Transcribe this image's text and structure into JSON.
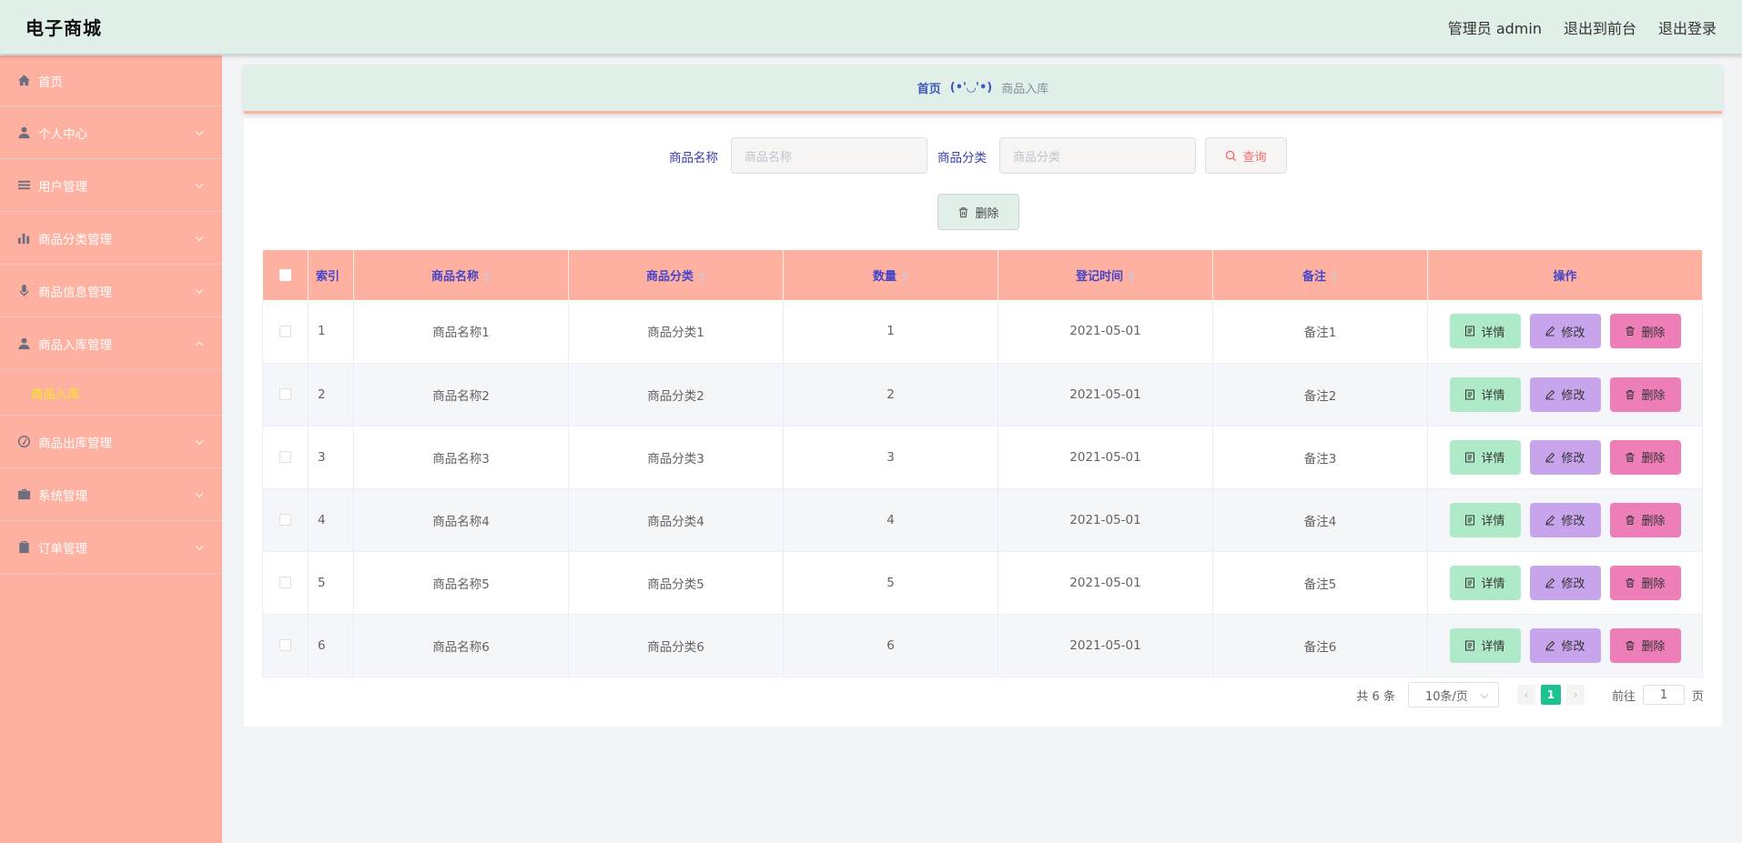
{
  "app": {
    "title": "电子商城"
  },
  "topnav": {
    "user": "管理员 admin",
    "front": "退出到前台",
    "logout": "退出登录"
  },
  "sidebar": {
    "items": [
      {
        "label": "首页",
        "icon": "home-icon"
      },
      {
        "label": "个人中心",
        "icon": "user-icon"
      },
      {
        "label": "用户管理",
        "icon": "list-icon"
      },
      {
        "label": "商品分类管理",
        "icon": "bar-chart-icon"
      },
      {
        "label": "商品信息管理",
        "icon": "microphone-icon"
      },
      {
        "label": "商品入库管理",
        "icon": "user-icon",
        "expanded": true,
        "children": [
          {
            "label": "商品入库",
            "active": true
          }
        ]
      },
      {
        "label": "商品出库管理",
        "icon": "gauge-icon"
      },
      {
        "label": "系统管理",
        "icon": "briefcase-icon"
      },
      {
        "label": "订单管理",
        "icon": "clipboard-icon"
      }
    ],
    "active_color": "#f5e81d"
  },
  "breadcrumb": {
    "home": "首页",
    "separator": "(•'◡'•)",
    "current": "商品入库"
  },
  "search": {
    "name_label": "商品名称",
    "name_placeholder": "商品名称",
    "category_label": "商品分类",
    "category_placeholder": "商品分类",
    "query_button": "查询"
  },
  "actions": {
    "delete": "删除"
  },
  "table": {
    "headers": {
      "index": "索引",
      "name": "商品名称",
      "category": "商品分类",
      "quantity": "数量",
      "time": "登记时间",
      "remark": "备注",
      "ops": "操作"
    },
    "rows": [
      {
        "index": "1",
        "name": "商品名称1",
        "category": "商品分类1",
        "quantity": "1",
        "time": "2021-05-01",
        "remark": "备注1"
      },
      {
        "index": "2",
        "name": "商品名称2",
        "category": "商品分类2",
        "quantity": "2",
        "time": "2021-05-01",
        "remark": "备注2"
      },
      {
        "index": "3",
        "name": "商品名称3",
        "category": "商品分类3",
        "quantity": "3",
        "time": "2021-05-01",
        "remark": "备注3"
      },
      {
        "index": "4",
        "name": "商品名称4",
        "category": "商品分类4",
        "quantity": "4",
        "time": "2021-05-01",
        "remark": "备注4"
      },
      {
        "index": "5",
        "name": "商品名称5",
        "category": "商品分类5",
        "quantity": "5",
        "time": "2021-05-01",
        "remark": "备注5"
      },
      {
        "index": "6",
        "name": "商品名称6",
        "category": "商品分类6",
        "quantity": "6",
        "time": "2021-05-01",
        "remark": "备注6"
      }
    ],
    "op_labels": {
      "detail": "详情",
      "edit": "修改",
      "delete": "删除"
    }
  },
  "pagination": {
    "total": "共 6 条",
    "page_size": "10条/页",
    "current": "1",
    "goto_prefix": "前往",
    "goto_value": "1",
    "goto_suffix": "页"
  },
  "colors": {
    "header_bg": "#e0efe8",
    "sidebar_bg": "#ffb1a1",
    "table_header_bg": "#ffb1a1",
    "detail_btn": "#aeeac7",
    "edit_btn": "#c7a4ec",
    "delete_btn": "#ed7eb8",
    "pager_active": "#1ec291"
  }
}
